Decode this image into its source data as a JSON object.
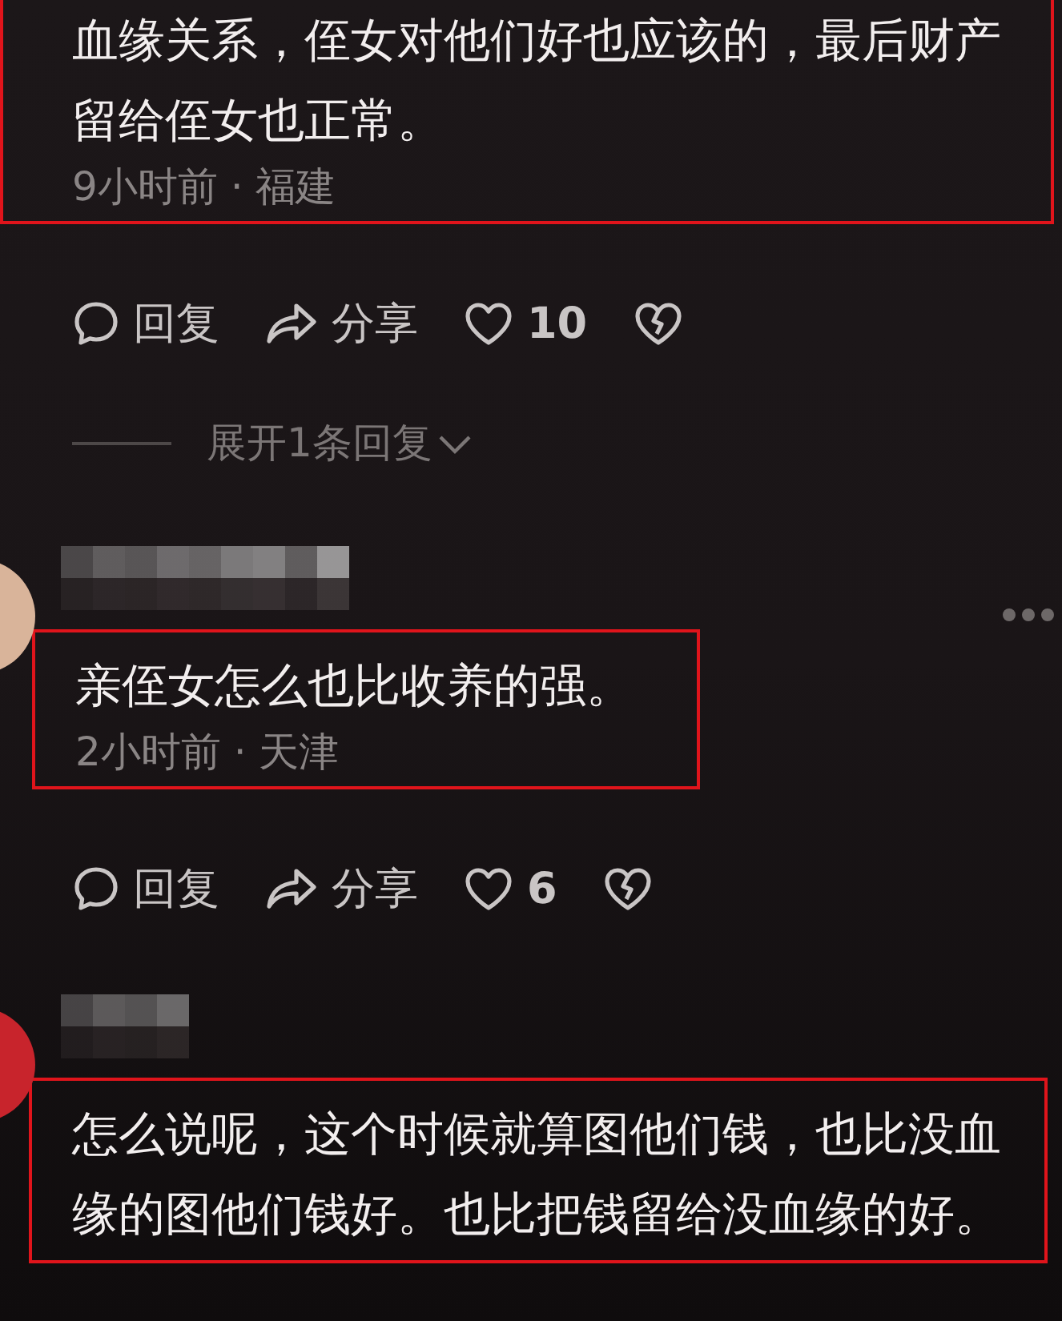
{
  "comments": [
    {
      "text": "血缘关系，侄女对他们好也应该的，最后财产留给侄女也正常。",
      "meta": "9小时前 · 福建",
      "highlighted": true,
      "actions": {
        "reply": "回复",
        "share": "分享",
        "likes": "10"
      },
      "expand_replies": "展开1条回复"
    },
    {
      "color": "#d9b49a",
      "text": "亲侄女怎么也比收养的强。",
      "meta": "2小时前 · 天津",
      "highlighted": true,
      "actions": {
        "reply": "回复",
        "share": "分享",
        "likes": "6"
      },
      "more_menu": true
    },
    {
      "color": "#c8242c",
      "text": "怎么说呢，这个时候就算图他们钱，也比没血缘的图他们钱好。也比把钱留给没血缘的好。",
      "highlighted": true
    }
  ]
}
